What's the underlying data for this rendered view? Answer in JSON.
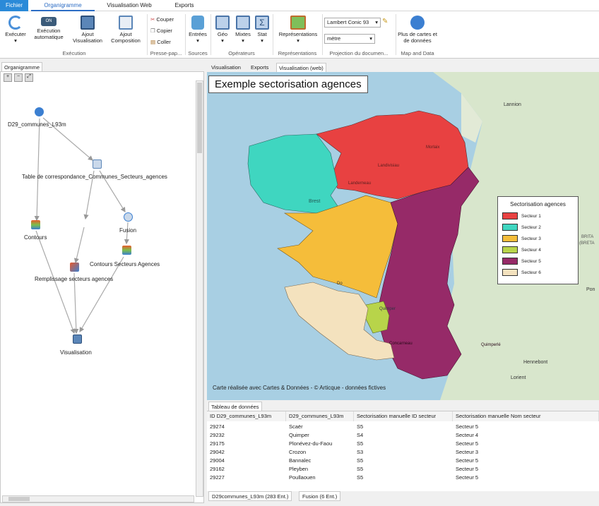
{
  "menu": {
    "file": "Fichier",
    "tabs": [
      "Organigramme",
      "Visualisation Web",
      "Exports"
    ]
  },
  "ribbon": {
    "execute": "Exécuter",
    "auto_exec": "Exécution automatique",
    "auto_state": "ON",
    "add_vis": "Ajout Visualisation",
    "add_comp": "Ajout Composition",
    "grp_exec": "Exécution",
    "cut": "Couper",
    "copy": "Copier",
    "paste": "Coller",
    "grp_clip": "Presse-pap...",
    "inputs": "Entrées",
    "grp_sources": "Sources",
    "geo": "Géo",
    "mixed": "Mixtes",
    "stat": "Stat",
    "grp_ops": "Opérateurs",
    "reps": "Représentations",
    "grp_reps": "Représentations",
    "projection": "Lambert Conic 93",
    "unit": "mètre",
    "grp_proj": "Projection du documen...",
    "more_maps": "Plus de cartes et de données",
    "grp_map": "Map and Data"
  },
  "left": {
    "tab": "Organigramme",
    "nodes": {
      "n1": "D29_communes_L93m",
      "n2": "Table de correspondance_Communes_Secteurs_agences",
      "n3": "Contours",
      "n4": "Fusion",
      "n5": "Contours Secteurs Agences",
      "n6": "Remplissage secteurs agences",
      "n7": "Visualisation"
    }
  },
  "view_tabs": [
    "Visualisation",
    "Exports",
    "Visualisation (web)"
  ],
  "map": {
    "title": "Exemple sectorisation agences",
    "legend_title": "Sectorisation agences",
    "legend": [
      {
        "label": "Secteur 1",
        "color": "#e84141"
      },
      {
        "label": "Secteur 2",
        "color": "#3fd6c0"
      },
      {
        "label": "Secteur 3",
        "color": "#f5bd3a"
      },
      {
        "label": "Secteur 4",
        "color": "#b8d44a"
      },
      {
        "label": "Secteur 5",
        "color": "#962a68"
      },
      {
        "label": "Secteur 6",
        "color": "#f4e2be"
      }
    ],
    "places": [
      "Lannion",
      "Morlaix",
      "Landivisiau",
      "Landerneau",
      "Brest",
      "Quimper",
      "Concarneau",
      "Quimperlé",
      "Lorient",
      "Hennebont",
      "BRITA",
      "(BRETA",
      "Pon",
      "Do"
    ],
    "credit": "Carte réalisée avec Cartes & Données - © Articque - données fictives"
  },
  "table": {
    "tab": "Tableau de données",
    "headers": [
      "ID D29_communes_L93m",
      "D29_communes_L93m",
      "Sectorisation manuelle ID secteur",
      "Sectorisation manuelle Nom secteur"
    ],
    "rows": [
      [
        "29274",
        "Scaër",
        "S5",
        "Secteur 5"
      ],
      [
        "29232",
        "Quimper",
        "S4",
        "Secteur 4"
      ],
      [
        "29175",
        "Plonévez-du-Faou",
        "S5",
        "Secteur 5"
      ],
      [
        "29042",
        "Crozon",
        "S3",
        "Secteur 3"
      ],
      [
        "29004",
        "Bannalec",
        "S5",
        "Secteur 5"
      ],
      [
        "29162",
        "Pleyben",
        "S5",
        "Secteur 5"
      ],
      [
        "29227",
        "Poullaouen",
        "S5",
        "Secteur 5"
      ]
    ]
  },
  "footer": {
    "tab1": "D29communes_L93m (283 Ent.)",
    "tab2": "Fusion (6 Ent.)"
  }
}
